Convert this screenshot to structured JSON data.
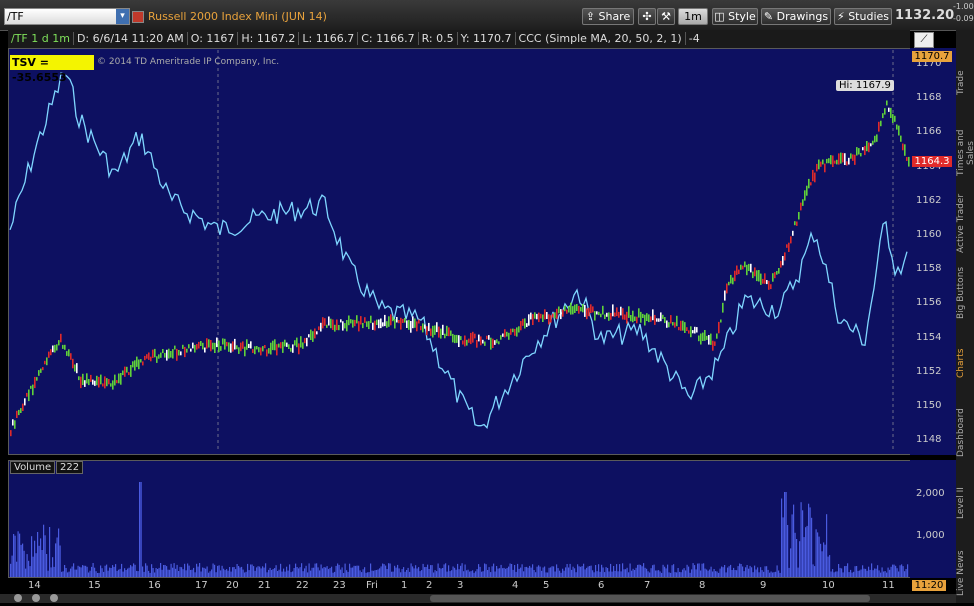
{
  "toolbar": {
    "symbol": "/TF",
    "instrument_title": "Russell 2000 Index Mini (JUN 14)",
    "share_label": "Share",
    "timeframe_label": "1m",
    "style_label": "Style",
    "drawings_label": "Drawings",
    "studies_label": "Studies",
    "last_price": "1132.20",
    "mini_change_1": "-1.00",
    "mini_change_2": "-0.09"
  },
  "infobar": {
    "symbol_period": "/TF 1 d 1m",
    "date": "D: 6/6/14 11:20 AM",
    "open": "O: 1167",
    "high": "H: 1167.2",
    "low": "L: 1166.7",
    "close": "C: 1166.7",
    "range": "R: 0.5",
    "y": "Y: 1170.7",
    "study": "CCC (Simple MA, 20, 50, 2, 1)",
    "study_value": "-4"
  },
  "price_chart": {
    "tsv_label": "TSV  = -35.6553",
    "copyright": "© 2014 TD Ameritrade IP Company, Inc.",
    "hi_label": "Hi: 1167.9",
    "current_price_tag": "1164.3",
    "top_price_tag": "1170.7",
    "y_ticks": [
      "1170",
      "1168",
      "1166",
      "1164",
      "1162",
      "1160",
      "1158",
      "1156",
      "1154",
      "1152",
      "1150",
      "1148"
    ]
  },
  "volume_chart": {
    "label": "Volume",
    "value": "222",
    "y_ticks": [
      "2,000",
      "1,000"
    ]
  },
  "time_axis": {
    "labels": [
      "14",
      "15",
      "16",
      "17",
      "20",
      "21",
      "22",
      "23",
      "Fri",
      "1",
      "2",
      "3",
      "4",
      "5",
      "6",
      "7",
      "8",
      "9",
      "10",
      "11"
    ],
    "current_time_tag": "11:20"
  },
  "right_rail": {
    "tabs": [
      "Trade",
      "Times and Sales",
      "Active Trader",
      "Big Buttons",
      "Charts",
      "Dashboard",
      "Level II",
      "Live News"
    ]
  },
  "colors": {
    "chart_bg": "#0d1061",
    "osc_line": "#7fd6ff",
    "up_bar": "#5fd23a",
    "down_bar": "#e02a2a",
    "price_tag": "#e8a23c"
  }
}
